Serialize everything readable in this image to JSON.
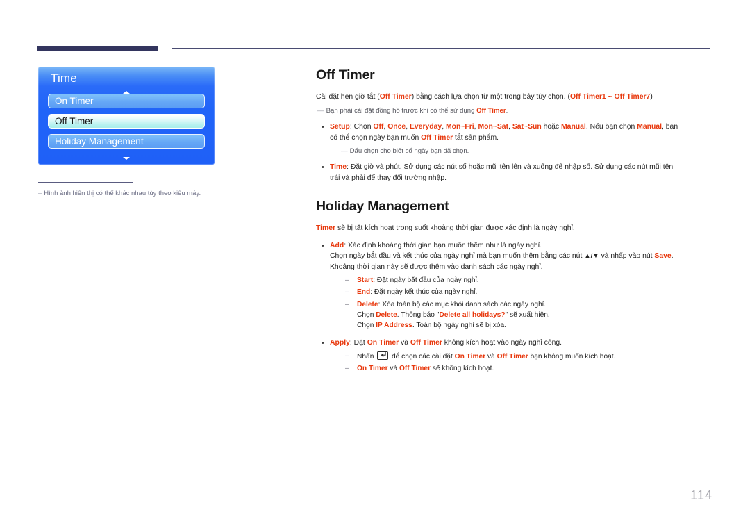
{
  "header": {
    "bar_color": "#33355e",
    "line_color": "#4a4c72"
  },
  "osd_menu": {
    "title": "Time",
    "scroll_up_icon": "triangle-up-icon",
    "scroll_down_icon": "triangle-down-icon",
    "selected_index": 1,
    "items": [
      {
        "label": "On Timer"
      },
      {
        "label": "Off Timer"
      },
      {
        "label": "Holiday Management"
      }
    ]
  },
  "figure_note": {
    "dash": "–",
    "text": "Hình ảnh hiển thị có thể khác nhau tùy theo kiểu máy."
  },
  "sections": [
    {
      "heading": "Off Timer",
      "intro": {
        "p1_a": "Cài đặt hẹn giờ tắt (",
        "p1_red1": "Off Timer",
        "p1_b": ") bằng cách lựa chọn từ một trong bảy tùy chọn. (",
        "p1_red2": "Off Timer1 ~ Off Timer7",
        "p1_c": ")"
      },
      "note1": {
        "dash": "—",
        "a": "Bạn phải cài đặt đồng hồ trước khi có thể sử dụng ",
        "red": "Off Timer",
        "b": "."
      },
      "bullets": [
        {
          "label": "Setup",
          "line1_a": ": Chọn ",
          "opts": [
            "Off",
            "Once",
            "Everyday",
            "Mon~Fri",
            "Mon~Sat",
            "Sat~Sun"
          ],
          "line1_b": " hoặc ",
          "opt_manual": "Manual",
          "line1_c": ". Nếu bạn chọn ",
          "opt_manual2": "Manual",
          "line1_d": ", bạn",
          "line2_a": "có thể chọn ngày bạn muốn ",
          "line2_red": "Off Timer",
          "line2_b": " tắt sản phẩm.",
          "note": {
            "dash": "—",
            "text": "Dấu chọn cho biết số ngày bạn đã chọn."
          }
        },
        {
          "label": "Time",
          "line1": ": Đặt giờ và phút. Sử dụng các nút số hoặc mũi tên lên và xuống để nhập số. Sử dụng các nút mũi tên",
          "line2": "trái và phải để thay đổi trường nhập."
        }
      ]
    },
    {
      "heading": "Holiday Management",
      "intro2": {
        "red": "Timer",
        "text": " sẽ bị tắt kích hoạt trong suốt khoảng thời gian được xác định là ngày nghỉ."
      },
      "bullets": [
        {
          "label": "Add",
          "line1": ": Xác định khoảng thời gian bạn muốn thêm như là ngày nghỉ.",
          "line2_a": "Chọn ngày bắt đầu và kết thúc của ngày nghỉ mà bạn muốn thêm bằng các nút ",
          "line2_arrows": "▲/▼",
          "line2_b": " và nhấp vào nút ",
          "line2_red": "Save",
          "line2_c": ".",
          "line3": "Khoảng thời gian này sẽ được thêm vào danh sách các ngày nghỉ.",
          "subs": [
            {
              "label": "Start",
              "text": ": Đặt ngày bắt đầu của ngày nghỉ."
            },
            {
              "label": "End",
              "text": ": Đặt ngày kết thúc của ngày nghỉ."
            },
            {
              "label": "Delete",
              "text": ": Xóa toàn bộ các mục khỏi danh sách các ngày nghỉ.",
              "extra1_a": "Chọn ",
              "extra1_red": "Delete",
              "extra1_b": ". Thông báo \"",
              "extra1_red2": "Delete all holidays?",
              "extra1_c": "\" sẽ xuất hiện.",
              "extra2_a": "Chọn ",
              "extra2_red": "IP Address",
              "extra2_b": ". Toàn bộ ngày nghỉ sẽ bị xóa."
            }
          ]
        },
        {
          "label": "Apply",
          "line1_a": ": Đặt ",
          "line1_red1": "On Timer",
          "line1_b": " và ",
          "line1_red2": "Off Timer",
          "line1_c": " không kích hoạt vào ngày nghỉ công.",
          "subs": [
            {
              "pre": "Nhấn ",
              "key_icon": "enter-key-icon",
              "mid_a": " để chọn các cài đặt ",
              "red1": "On Timer",
              "mid_b": " và ",
              "red2": "Off Timer",
              "post": " bạn không muốn kích hoạt."
            },
            {
              "red1": "On Timer",
              "mid": " và ",
              "red2": "Off Timer",
              "post": " sẽ không kích hoạt."
            }
          ]
        }
      ]
    }
  ],
  "page_number": "114",
  "accent_red": "#e8380d",
  "menu_blue": "#2064f8",
  "menu_highlight": "#b6f2ef"
}
